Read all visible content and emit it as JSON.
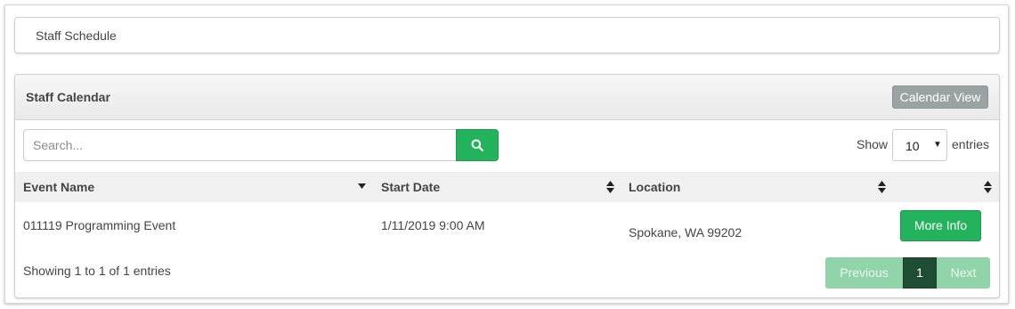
{
  "breadcrumb": {
    "label": "Staff Schedule"
  },
  "panel": {
    "title": "Staff Calendar",
    "calendar_view_label": "Calendar View"
  },
  "search": {
    "placeholder": "Search...",
    "value": ""
  },
  "length": {
    "show_label": "Show",
    "value": "10",
    "entries_label": "entries"
  },
  "table": {
    "columns": [
      "Event Name",
      "Start Date",
      "Location",
      ""
    ],
    "rows": [
      {
        "event_name": "011119 Programming Event",
        "start_date": "1/11/2019 9:00 AM",
        "location": "Spokane, WA 99202",
        "action_label": "More Info"
      }
    ]
  },
  "info": "Showing 1 to 1 of 1 entries",
  "pagination": {
    "previous": "Previous",
    "current": "1",
    "next": "Next"
  },
  "colors": {
    "accent": "#22b35c",
    "calendar_button": "#9aa3a3",
    "active_page": "#1f4d33",
    "disabled_page": "#92d4aa"
  },
  "icons": {
    "search": "search-icon",
    "sort_desc": "sort-desc-icon",
    "sort_both": "sort-both-icon"
  }
}
